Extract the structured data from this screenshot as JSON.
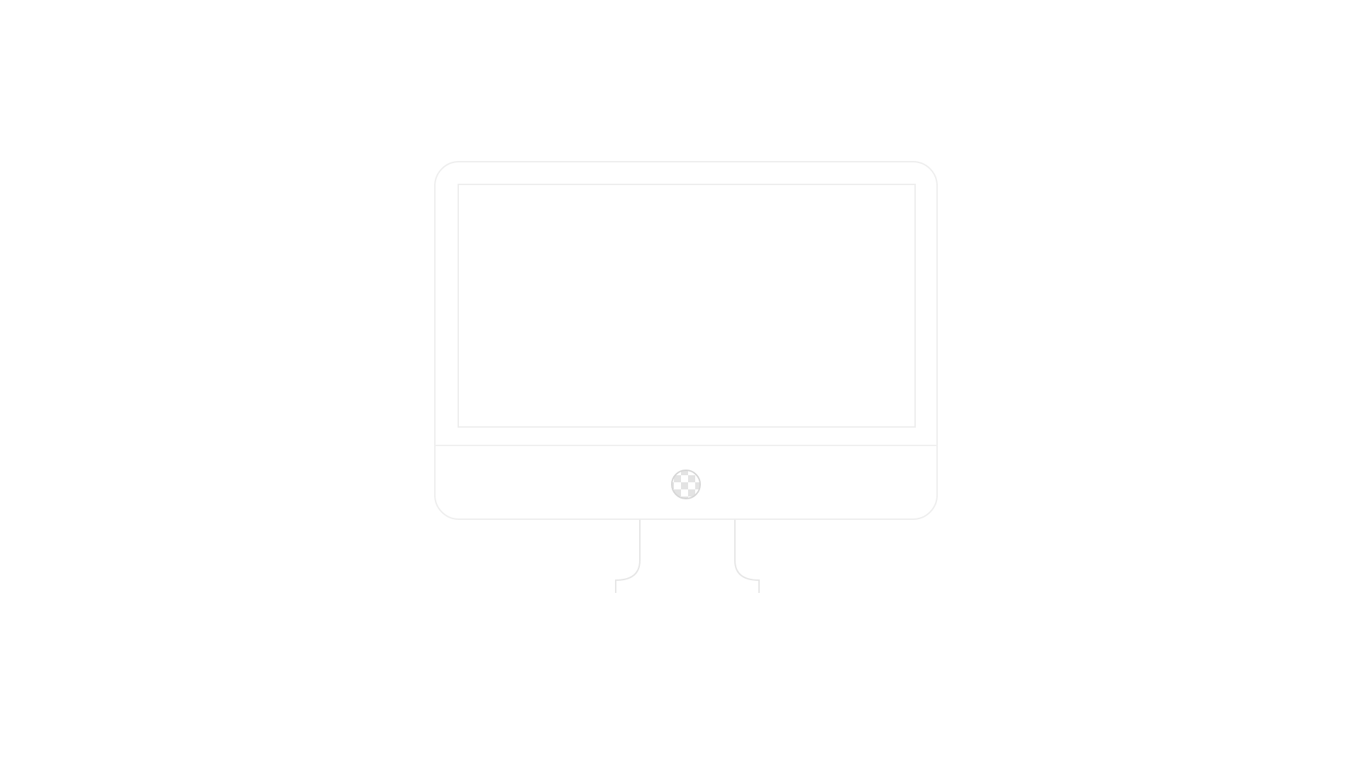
{
  "icon": {
    "name": "desktop-monitor-icon",
    "fill_color": "#ffffff",
    "outline_color": "#e6e6e6",
    "background_color": "#ffffff",
    "power_button_pattern": "checkerboard",
    "checker_light": "#ffffff",
    "checker_dark": "#e3e3e3"
  }
}
